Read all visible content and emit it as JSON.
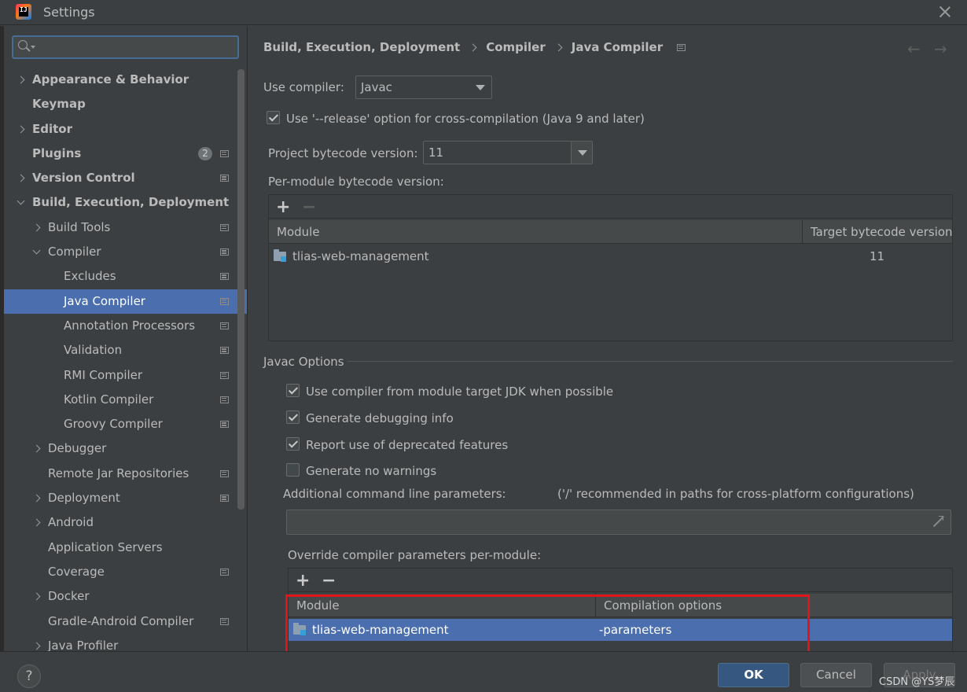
{
  "window": {
    "title": "Settings",
    "app_logo_text": "IJ"
  },
  "search": {
    "placeholder": ""
  },
  "sidebar": {
    "items": [
      {
        "label": "Appearance & Behavior",
        "expand": "right",
        "bold": true,
        "indent": 0,
        "icon": false
      },
      {
        "label": "Keymap",
        "expand": "none",
        "bold": true,
        "indent": 0,
        "icon": false
      },
      {
        "label": "Editor",
        "expand": "right",
        "bold": true,
        "indent": 0,
        "icon": false
      },
      {
        "label": "Plugins",
        "expand": "none",
        "bold": true,
        "indent": 0,
        "icon": true,
        "badge": "2"
      },
      {
        "label": "Version Control",
        "expand": "right",
        "bold": true,
        "indent": 0,
        "icon": true
      },
      {
        "label": "Build, Execution, Deployment",
        "expand": "down",
        "bold": true,
        "indent": 0,
        "icon": false
      },
      {
        "label": "Build Tools",
        "expand": "right",
        "bold": false,
        "indent": 1,
        "icon": true
      },
      {
        "label": "Compiler",
        "expand": "down",
        "bold": false,
        "indent": 1,
        "icon": true
      },
      {
        "label": "Excludes",
        "expand": "none",
        "bold": false,
        "indent": 2,
        "icon": true
      },
      {
        "label": "Java Compiler",
        "expand": "none",
        "bold": false,
        "indent": 2,
        "icon": true,
        "selected": true
      },
      {
        "label": "Annotation Processors",
        "expand": "none",
        "bold": false,
        "indent": 2,
        "icon": true
      },
      {
        "label": "Validation",
        "expand": "none",
        "bold": false,
        "indent": 2,
        "icon": true
      },
      {
        "label": "RMI Compiler",
        "expand": "none",
        "bold": false,
        "indent": 2,
        "icon": true
      },
      {
        "label": "Kotlin Compiler",
        "expand": "none",
        "bold": false,
        "indent": 2,
        "icon": true
      },
      {
        "label": "Groovy Compiler",
        "expand": "none",
        "bold": false,
        "indent": 2,
        "icon": true
      },
      {
        "label": "Debugger",
        "expand": "right",
        "bold": false,
        "indent": 1,
        "icon": false
      },
      {
        "label": "Remote Jar Repositories",
        "expand": "none",
        "bold": false,
        "indent": 1,
        "icon": true
      },
      {
        "label": "Deployment",
        "expand": "right",
        "bold": false,
        "indent": 1,
        "icon": true
      },
      {
        "label": "Android",
        "expand": "right",
        "bold": false,
        "indent": 1,
        "icon": false
      },
      {
        "label": "Application Servers",
        "expand": "none",
        "bold": false,
        "indent": 1,
        "icon": false
      },
      {
        "label": "Coverage",
        "expand": "none",
        "bold": false,
        "indent": 1,
        "icon": true
      },
      {
        "label": "Docker",
        "expand": "right",
        "bold": false,
        "indent": 1,
        "icon": false
      },
      {
        "label": "Gradle-Android Compiler",
        "expand": "none",
        "bold": false,
        "indent": 1,
        "icon": true
      },
      {
        "label": "Java Profiler",
        "expand": "right",
        "bold": false,
        "indent": 1,
        "icon": false
      }
    ]
  },
  "breadcrumb": {
    "parts": [
      "Build, Execution, Deployment",
      "Compiler",
      "Java Compiler"
    ],
    "back": "←",
    "forward": "→"
  },
  "compiler": {
    "use_compiler_label": "Use compiler:",
    "use_compiler_value": "Javac",
    "release_option_label": "Use '--release' option for cross-compilation (Java 9 and later)",
    "release_option_checked": true,
    "bytecode_label": "Project bytecode version:",
    "bytecode_value": "11",
    "per_module_label": "Per-module bytecode version:"
  },
  "module_table": {
    "plus": "+",
    "minus": "−",
    "columns": [
      "Module",
      "Target bytecode version"
    ],
    "rows": [
      {
        "module": "tlias-web-management",
        "version": "11"
      }
    ]
  },
  "javac": {
    "section_title": "Javac Options",
    "options": [
      {
        "label": "Use compiler from module target JDK when possible",
        "checked": true
      },
      {
        "label": "Generate debugging info",
        "checked": true
      },
      {
        "label": "Report use of deprecated features",
        "checked": true
      },
      {
        "label": "Generate no warnings",
        "checked": false
      }
    ],
    "additional_params_label": "Additional command line parameters:",
    "additional_params_hint": "('/' recommended in paths for cross-platform configurations)",
    "additional_params_value": "",
    "override_label": "Override compiler parameters per-module:"
  },
  "override_table": {
    "plus": "+",
    "minus": "−",
    "columns": [
      "Module",
      "Compilation options"
    ],
    "rows": [
      {
        "module": "tlias-web-management",
        "options": "-parameters"
      }
    ]
  },
  "footer": {
    "help": "?",
    "ok": "OK",
    "cancel": "Cancel",
    "apply": "Apply",
    "watermark": "CSDN @YS梦辰"
  },
  "colors": {
    "background": "#3c3f41",
    "selection": "#4b6eaf",
    "highlight_box": "#e0141b",
    "ok_button": "#365880"
  }
}
